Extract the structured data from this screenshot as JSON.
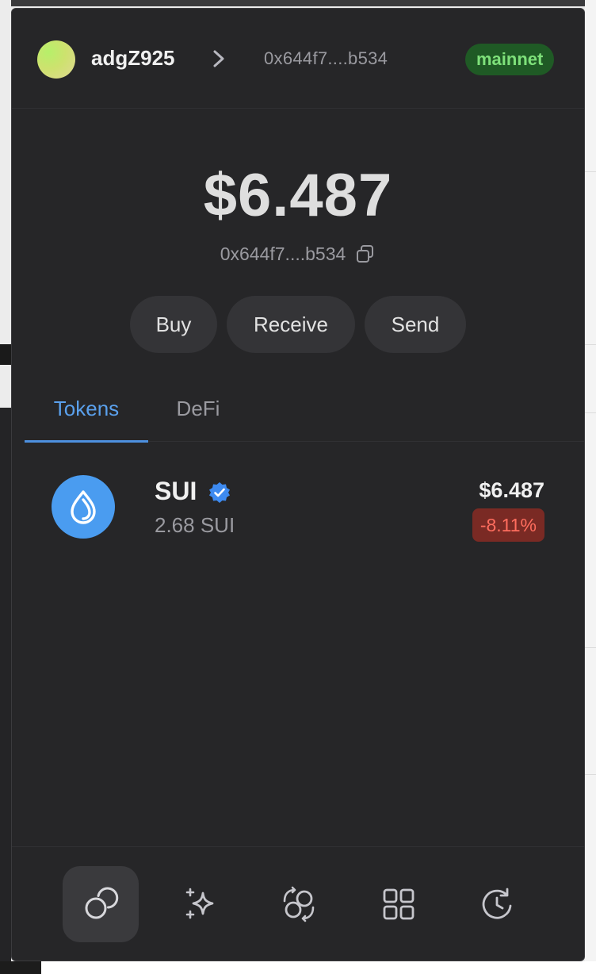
{
  "account": {
    "name": "adgZ925",
    "short_address": "0x644f7....b534",
    "network": "mainnet"
  },
  "balance": {
    "total": "$6.487",
    "address": "0x644f7....b534"
  },
  "actions": {
    "buy": "Buy",
    "receive": "Receive",
    "send": "Send"
  },
  "tabs": {
    "tokens": "Tokens",
    "defi": "DeFi",
    "active": "Tokens"
  },
  "tokens": [
    {
      "symbol": "SUI",
      "verified": true,
      "amount": "2.68 SUI",
      "value": "$6.487",
      "change": "-8.11%",
      "logo_icon": "sui-droplet-icon"
    }
  ],
  "nav": [
    {
      "icon": "coins-icon",
      "active": true
    },
    {
      "icon": "sparkles-icon",
      "active": false
    },
    {
      "icon": "swap-icon",
      "active": false
    },
    {
      "icon": "apps-grid-icon",
      "active": false
    },
    {
      "icon": "history-icon",
      "active": false
    }
  ],
  "colors": {
    "background": "#262628",
    "accent": "#4d90e0",
    "network_badge": "#1f5a25",
    "negative_change": "#7a2a24"
  }
}
